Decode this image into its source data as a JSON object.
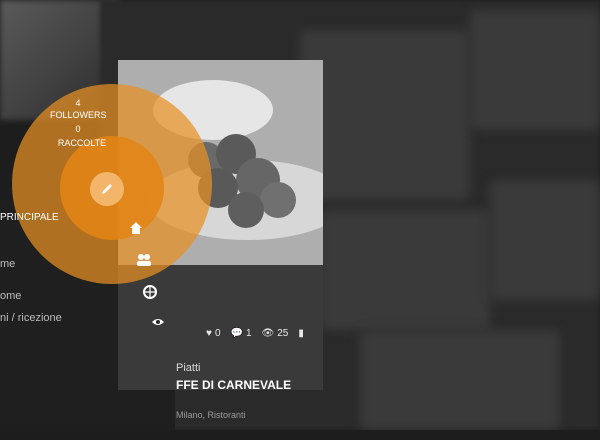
{
  "profile": {
    "followers_count": "4",
    "followers_label": "FOLLOWERS",
    "raccolte_count": "0",
    "raccolte_label": "RACCOLTE"
  },
  "nav": {
    "section_label": "PRINCIPALE",
    "items": [
      "me",
      "ome",
      "ni / ricezione"
    ],
    "icons": [
      "home-icon",
      "users-icon",
      "globe-icon",
      "eye-icon"
    ]
  },
  "card": {
    "likes": "0",
    "comments": "1",
    "views": "25",
    "category": "Piatti",
    "title": "FFE DI CARNEVALE",
    "author": "Milano, Ristoranti"
  },
  "colors": {
    "accent": "#e89123",
    "background": "#1d1d1d",
    "card": "#3a3a3a"
  }
}
